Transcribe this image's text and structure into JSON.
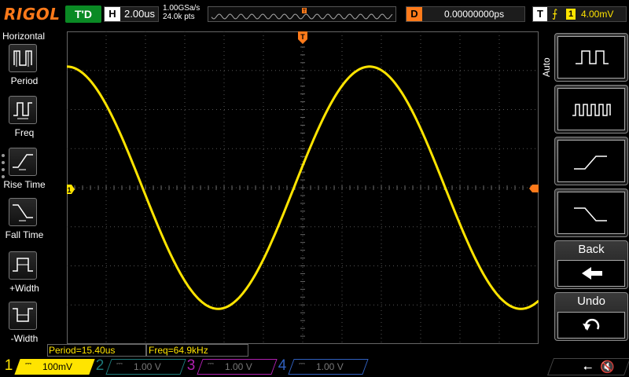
{
  "header": {
    "brand": "RIGOL",
    "run_status": "T'D",
    "horizontal_tag": "H",
    "timebase": "2.00us",
    "sample_rate": "1.00GSa/s",
    "memory_depth": "24.0k pts",
    "trigger_marker": "T",
    "delay_tag": "D",
    "delay_value": "0.00000000ps",
    "trigger_tag": "T",
    "trigger_edge": "rising-edge-icon",
    "trigger_source": "1",
    "trigger_level": "4.00mV"
  },
  "left_menu": {
    "title": "Horizontal",
    "items": [
      {
        "label": "Period",
        "icon": "period-icon"
      },
      {
        "label": "Freq",
        "icon": "frequency-icon"
      },
      {
        "label": "Rise Time",
        "icon": "rise-time-icon"
      },
      {
        "label": "Fall Time",
        "icon": "fall-time-icon"
      },
      {
        "label": "+Width",
        "icon": "positive-width-icon"
      },
      {
        "label": "-Width",
        "icon": "negative-width-icon"
      }
    ]
  },
  "right_menu": {
    "mode": "Auto",
    "buttons": [
      {
        "icon": "single-period-pulse-icon"
      },
      {
        "icon": "multi-period-pulse-icon"
      },
      {
        "icon": "rising-edge-icon"
      },
      {
        "icon": "falling-edge-icon"
      },
      {
        "label": "Back",
        "icon": "back-arrow-icon",
        "symbol": "🡸"
      },
      {
        "label": "Undo",
        "icon": "undo-icon",
        "symbol": "↶"
      }
    ]
  },
  "measurements": {
    "period": "Period=15.40us",
    "freq": "Freq=64.9kHz"
  },
  "waveform": {
    "channel_marker": "1",
    "color": "#ffe400",
    "period_divisions": 7.7,
    "amplitude_divisions": 3.1
  },
  "channels": [
    {
      "num": "1",
      "coupling": "⎓",
      "scale": "100mV",
      "color": "#ffe400",
      "active": true
    },
    {
      "num": "2",
      "coupling": "⎓",
      "scale": "1.00 V",
      "color": "#1d7a7a",
      "active": false
    },
    {
      "num": "3",
      "coupling": "⎓",
      "scale": "1.00 V",
      "color": "#b020b0",
      "active": false
    },
    {
      "num": "4",
      "coupling": "⎓",
      "scale": "1.00 V",
      "color": "#3060c0",
      "active": false
    }
  ],
  "status": {
    "usb": "⭠",
    "mute": "🔇"
  }
}
